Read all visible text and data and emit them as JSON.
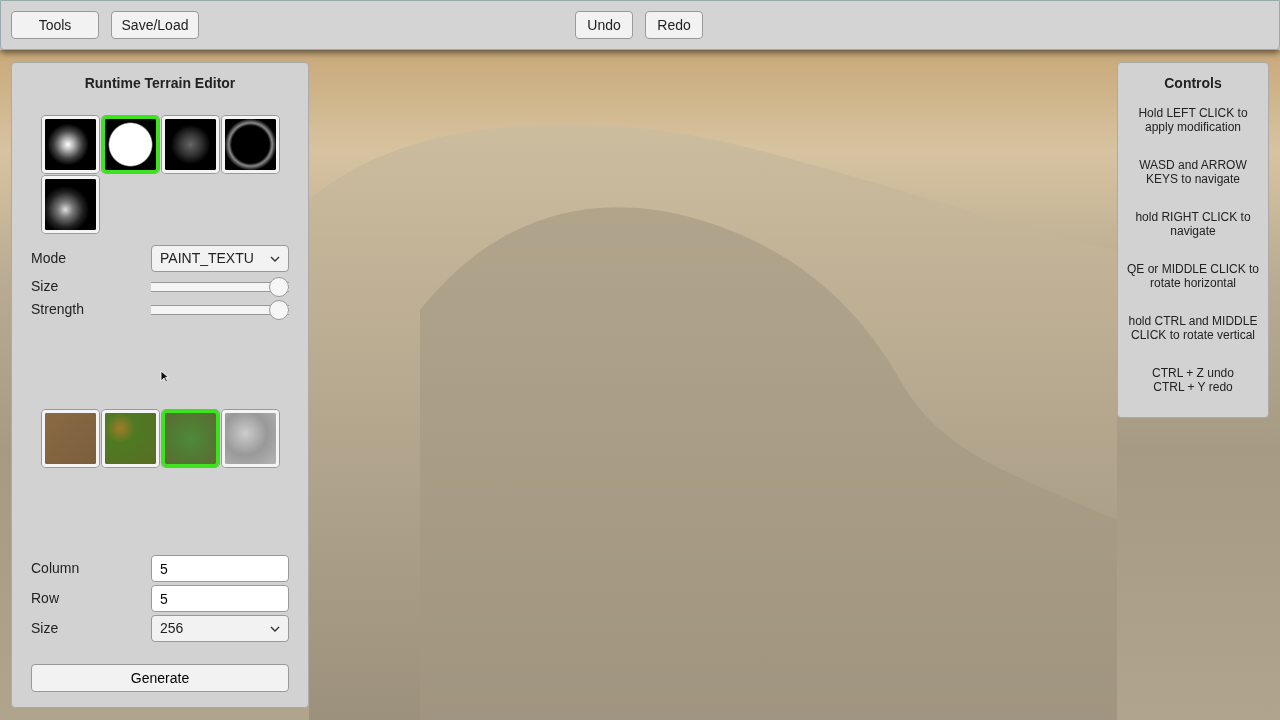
{
  "toolbar": {
    "left_buttons": [
      "Tools",
      "Save/Load"
    ],
    "center_buttons": [
      "Undo",
      "Redo"
    ]
  },
  "editor_panel": {
    "title": "Runtime Terrain Editor",
    "brushes": [
      {
        "selected": false
      },
      {
        "selected": true
      },
      {
        "selected": false
      },
      {
        "selected": false
      },
      {
        "selected": false
      }
    ],
    "mode": {
      "label": "Mode",
      "value": "PAINT_TEXTU"
    },
    "sliders": [
      {
        "label": "Size",
        "level": 1.0
      },
      {
        "label": "Strength",
        "level": 1.0
      }
    ],
    "textures": [
      {
        "selected": false
      },
      {
        "selected": false
      },
      {
        "selected": true
      },
      {
        "selected": false
      }
    ],
    "generate_fields": [
      {
        "kind": "input",
        "label": "Column",
        "value": "5"
      },
      {
        "kind": "input",
        "label": "Row",
        "value": "5"
      },
      {
        "kind": "select",
        "label": "Size",
        "value": "256"
      }
    ],
    "generate_button": "Generate"
  },
  "controls_panel": {
    "title": "Controls",
    "hints": [
      {
        "lines": [
          "Hold LEFT CLICK to",
          "apply modification"
        ]
      },
      {
        "lines": [
          "WASD and ARROW",
          "KEYS to navigate"
        ]
      },
      {
        "lines": [
          "hold RIGHT CLICK to",
          "navigate"
        ]
      },
      {
        "lines": [
          "QE or MIDDLE CLICK to",
          "rotate horizontal"
        ]
      },
      {
        "lines": [
          "hold CTRL and MIDDLE",
          "CLICK to rotate vertical"
        ]
      },
      {
        "lines": [
          "CTRL + Z undo",
          "CTRL + Y redo"
        ]
      }
    ]
  }
}
